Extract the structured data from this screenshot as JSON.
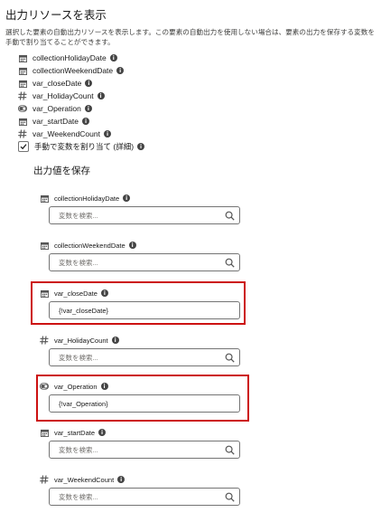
{
  "header": {
    "title": "出力リソースを表示",
    "description": "選択した要素の自動出力リソースを表示します。この要素の自動出力を使用しない場合は、要素の出力を保存する変数を手動で割り当てることができます。"
  },
  "outputs": [
    {
      "name": "collectionHolidayDate",
      "icon": "calendar-icon"
    },
    {
      "name": "collectionWeekendDate",
      "icon": "calendar-icon"
    },
    {
      "name": "var_closeDate",
      "icon": "calendar-icon"
    },
    {
      "name": "var_HolidayCount",
      "icon": "hash-icon"
    },
    {
      "name": "var_Operation",
      "icon": "toggle-icon"
    },
    {
      "name": "var_startDate",
      "icon": "calendar-icon"
    },
    {
      "name": "var_WeekendCount",
      "icon": "hash-icon"
    }
  ],
  "manual_assign": {
    "label": "手動で変数を割り当て (詳細)",
    "checked": true
  },
  "save_section": {
    "heading": "出力値を保存"
  },
  "fields": [
    {
      "label": "collectionHolidayDate",
      "icon": "calendar-icon",
      "value": "",
      "placeholder": "変数を検索..."
    },
    {
      "label": "collectionWeekendDate",
      "icon": "calendar-icon",
      "value": "",
      "placeholder": "変数を検索..."
    },
    {
      "label": "var_closeDate",
      "icon": "calendar-icon",
      "value": "{!var_closeDate}",
      "placeholder": "",
      "highlighted": true
    },
    {
      "label": "var_HolidayCount",
      "icon": "hash-icon",
      "value": "",
      "placeholder": "変数を検索..."
    },
    {
      "label": "var_Operation",
      "icon": "toggle-icon",
      "value": "{!var_Operation}",
      "placeholder": "",
      "highlighted": true
    },
    {
      "label": "var_startDate",
      "icon": "calendar-icon",
      "value": "",
      "placeholder": "変数を検索..."
    },
    {
      "label": "var_WeekendCount",
      "icon": "hash-icon",
      "value": "",
      "placeholder": "変数を検索..."
    }
  ],
  "icons": {
    "info": "i",
    "highlight_color": "#cc1111"
  }
}
